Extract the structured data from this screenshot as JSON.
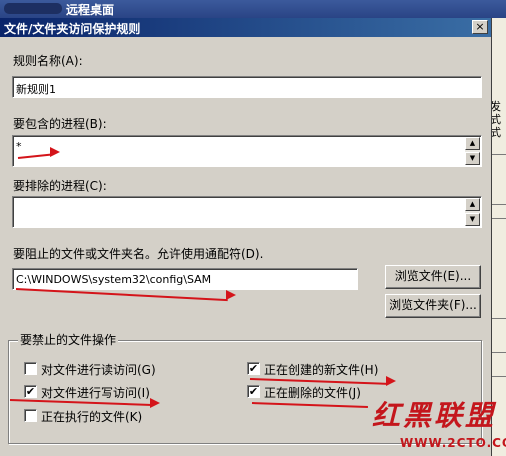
{
  "remote_desktop": {
    "title": "远程桌面"
  },
  "dialog": {
    "title": "文件/文件夹访问保护规则",
    "close_glyph": "×",
    "rule_name": {
      "label": "规则名称(A):",
      "value": "新规则1"
    },
    "include": {
      "label": "要包含的进程(B):",
      "value": "*"
    },
    "exclude": {
      "label": "要排除的进程(C):",
      "value": ""
    },
    "block_path": {
      "label": "要阻止的文件或文件夹名。允许使用通配符(D).",
      "value": "C:\\WINDOWS\\system32\\config\\SAM"
    },
    "browse_file_label": "浏览文件(E)...",
    "browse_folder_label": "浏览文件夹(F)...",
    "ops": {
      "title": "要禁止的文件操作",
      "read": {
        "label": "对文件进行读访问(G)",
        "checked": false
      },
      "write": {
        "label": "对文件进行写访问(I)",
        "checked": true
      },
      "exec": {
        "label": "正在执行的文件(K)",
        "checked": false
      },
      "create": {
        "label": "正在创建的新文件(H)",
        "checked": true
      },
      "delete": {
        "label": "正在删除的文件(J)",
        "checked": true
      }
    }
  },
  "background_window": {
    "fragment_text": "发\n式\n式"
  },
  "watermark": {
    "text_cn": "红黑联盟",
    "text_url": "WWW.2CTO.COM"
  },
  "glyphs": {
    "check": "✔",
    "up": "▲",
    "down": "▼"
  },
  "colors": {
    "annotation_red": "#d4141a",
    "title_blue": "#0a246a"
  }
}
